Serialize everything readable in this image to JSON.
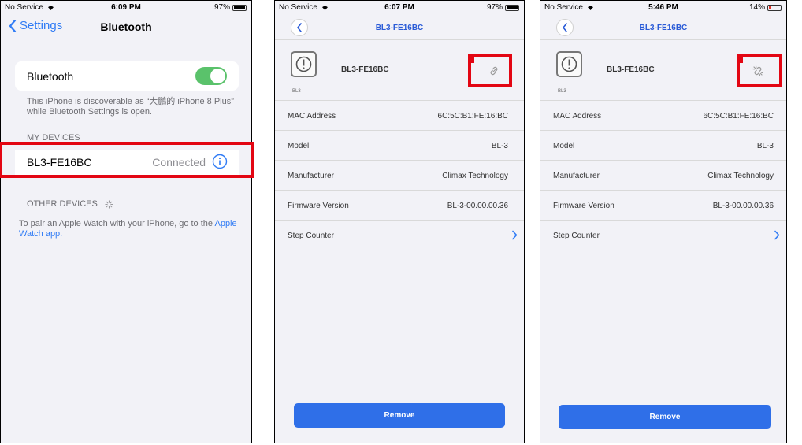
{
  "screen1": {
    "status": {
      "carrier": "No Service",
      "time": "6:09 PM",
      "battery": "97%"
    },
    "nav": {
      "back_label": "Settings",
      "title": "Bluetooth"
    },
    "bluetooth_row": {
      "label": "Bluetooth",
      "enabled": true
    },
    "discoverable_note": "This iPhone is discoverable as “大鵬的 iPhone 8 Plus” while Bluetooth Settings is open.",
    "my_devices_header": "MY DEVICES",
    "device": {
      "name": "BL3-FE16BC",
      "status": "Connected"
    },
    "other_devices_header": "OTHER DEVICES",
    "watch_note_prefix": "To pair an Apple Watch with your iPhone, go to the",
    "watch_note_link": "Apple Watch app."
  },
  "screen2": {
    "status": {
      "carrier": "No Service",
      "time": "6:07 PM",
      "battery": "97%"
    },
    "nav_title": "BL3-FE16BC",
    "device_caption": "BL3",
    "device_name": "BL3-FE16BC",
    "link_state": "connected",
    "details": [
      {
        "key": "MAC Address",
        "value": "6C:5C:B1:FE:16:BC"
      },
      {
        "key": "Model",
        "value": "BL-3"
      },
      {
        "key": "Manufacturer",
        "value": "Climax Technology"
      },
      {
        "key": "Firmware Version",
        "value": "BL-3-00.00.00.36"
      },
      {
        "key": "Step Counter",
        "value": ""
      }
    ],
    "remove_label": "Remove"
  },
  "screen3": {
    "status": {
      "carrier": "No Service",
      "time": "5:46 PM",
      "battery": "14%"
    },
    "nav_title": "BL3-FE16BC",
    "device_caption": "BL3",
    "device_name": "BL3-FE16BC",
    "link_state": "disconnected",
    "details": [
      {
        "key": "MAC Address",
        "value": "6C:5C:B1:FE:16:BC"
      },
      {
        "key": "Model",
        "value": "BL-3"
      },
      {
        "key": "Manufacturer",
        "value": "Climax Technology"
      },
      {
        "key": "Firmware Version",
        "value": "BL-3-00.00.00.36"
      },
      {
        "key": "Step Counter",
        "value": ""
      }
    ],
    "remove_label": "Remove"
  },
  "colors": {
    "ios_blue": "#2f7bf5",
    "toggle_green": "#5ac26b",
    "title_blue": "#2a5bd7",
    "button_blue": "#2f6fe8",
    "highlight_red": "#e30613"
  }
}
